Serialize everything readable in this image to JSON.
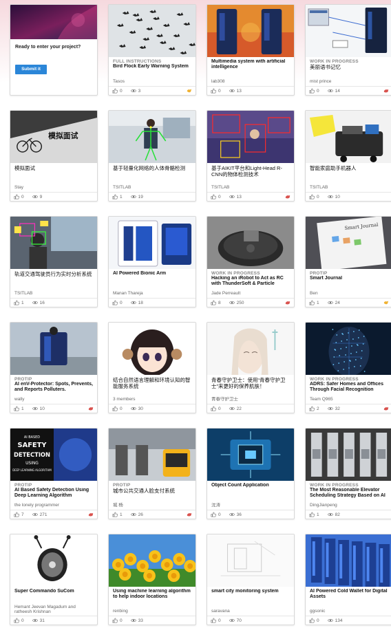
{
  "cta": {
    "text": "Ready to enter your project?",
    "button": "Submit it"
  },
  "cards": [
    {
      "tag": "FULL INSTRUCTIONS",
      "title": "Bird Flock Early Warning System",
      "author": "Tasos",
      "likes": "0",
      "views": "3",
      "flag": "respect",
      "thumb": "birds"
    },
    {
      "tag": "",
      "title": "Multimedia system with artificial intelligence",
      "author": "lab308",
      "likes": "0",
      "views": "13",
      "flag": "",
      "thumb": "device2"
    },
    {
      "tag": "WORK IN PROGRESS",
      "title": "美丽语书记忆",
      "author": "mist prince",
      "likes": "0",
      "views": "14",
      "flag": "skull",
      "thumb": "diagram"
    },
    {
      "tag": "",
      "title": "模拟面试",
      "author": "Stay",
      "likes": "0",
      "views": "9",
      "flag": "",
      "thumb": "bike"
    },
    {
      "tag": "",
      "title": "基于轻量化网络的人体骨骼检测",
      "author": "TSITLAB",
      "likes": "1",
      "views": "19",
      "flag": "",
      "thumb": "skeleton"
    },
    {
      "tag": "",
      "title": "基于AIKIT平台和Light-Head R-CNN的物体检测技术",
      "author": "TSITLAB",
      "likes": "0",
      "views": "13",
      "flag": "skull",
      "thumb": "detect"
    },
    {
      "tag": "",
      "title": "智能家庭助手机器人",
      "author": "TSITLAB",
      "likes": "0",
      "views": "10",
      "flag": "",
      "thumb": "robot"
    },
    {
      "tag": "",
      "title": "轨道交通驾驶员行为实时分析系统",
      "author": "TSITLAB",
      "likes": "1",
      "views": "16",
      "flag": "",
      "thumb": "driver"
    },
    {
      "tag": "",
      "title": "AI Powered Bionic Arm",
      "author": "Manan Thareja",
      "likes": "0",
      "views": "18",
      "flag": "",
      "thumb": "blue-device"
    },
    {
      "tag": "WORK IN PROGRESS",
      "title": "Hacking an iRobot to Act as RC with ThunderSoft & Particle",
      "author": "Jade Perreault",
      "likes": "8",
      "views": "250",
      "flag": "skull",
      "thumb": "roomba"
    },
    {
      "tag": "PROTIP",
      "title": "Smart Journal",
      "author": "Ben",
      "likes": "1",
      "views": "24",
      "flag": "respect",
      "thumb": "journal"
    },
    {
      "tag": "PROTIP",
      "title": "AI enV-Protector: Spots, Prevents, and Reports Polluters.",
      "author": "wally",
      "likes": "1",
      "views": "10",
      "flag": "skull",
      "thumb": "sensor"
    },
    {
      "tag": "",
      "title": "结合自然语言理解和环境认知的智能服务系统",
      "author": "3 members",
      "likes": "0",
      "views": "30",
      "flag": "",
      "thumb": "anime"
    },
    {
      "tag": "",
      "title": "青春守护卫士：使用“青春守护卫士”来更好的保养肌肤！",
      "author": "青春守护卫士",
      "likes": "0",
      "views": "22",
      "flag": "",
      "thumb": "face"
    },
    {
      "tag": "WORK IN PROGRESS",
      "title": "ADRS: Safer Homes and Offices Through Facial Recognition",
      "author": "Team Q965",
      "likes": "2",
      "views": "32",
      "flag": "skull",
      "thumb": "mesh"
    },
    {
      "tag": "PROTIP",
      "title": "AI Based Safety Detection Using Deep Learning Algorithm",
      "author": "the lonely programmer",
      "likes": "7",
      "views": "271",
      "flag": "skull",
      "thumb": "safety"
    },
    {
      "tag": "PROTIP",
      "title": "城市公共交通人脸支付系统",
      "author": "城 杨",
      "likes": "1",
      "views": "26",
      "flag": "skull",
      "thumb": "gates"
    },
    {
      "tag": "",
      "title": "Object Count Application",
      "author": "沈涛",
      "likes": "0",
      "views": "36",
      "flag": "",
      "thumb": "chip"
    },
    {
      "tag": "WORK IN PROGRESS",
      "title": "The Most Reasonable Elevator Scheduling Strategy Based on AI",
      "author": "DingJianpeng",
      "likes": "1",
      "views": "82",
      "flag": "",
      "thumb": "elevator"
    },
    {
      "tag": "",
      "title": "Super Commando SuCom",
      "author": "Hemant Jeevan Magadum and ratheesh Krishnan",
      "likes": "0",
      "views": "31",
      "flag": "",
      "thumb": "commando"
    },
    {
      "tag": "",
      "title": "Using machine learning algorithm to help indoor locations",
      "author": "renbing",
      "likes": "0",
      "views": "33",
      "flag": "",
      "thumb": "flowers"
    },
    {
      "tag": "",
      "title": "smart city monitoring system",
      "author": "saravana",
      "likes": "0",
      "views": "70",
      "flag": "",
      "thumb": "sketch"
    },
    {
      "tag": "",
      "title": "AI Powered Cold Wallet for Digital Assets",
      "author": "ggsonic",
      "likes": "0",
      "views": "134",
      "flag": "",
      "thumb": "wallet"
    }
  ],
  "thumb_texts": {
    "bike": "模拟面试",
    "safety": [
      "AI BASED",
      "SAFETY",
      "DETECTION",
      "USING",
      "DEEP LEARNING ALGORITHM"
    ],
    "journal": "Smart Journal"
  },
  "colors": {
    "accent": "#2b86d8",
    "respect": "#f0b232",
    "skull": "#d9534f"
  }
}
